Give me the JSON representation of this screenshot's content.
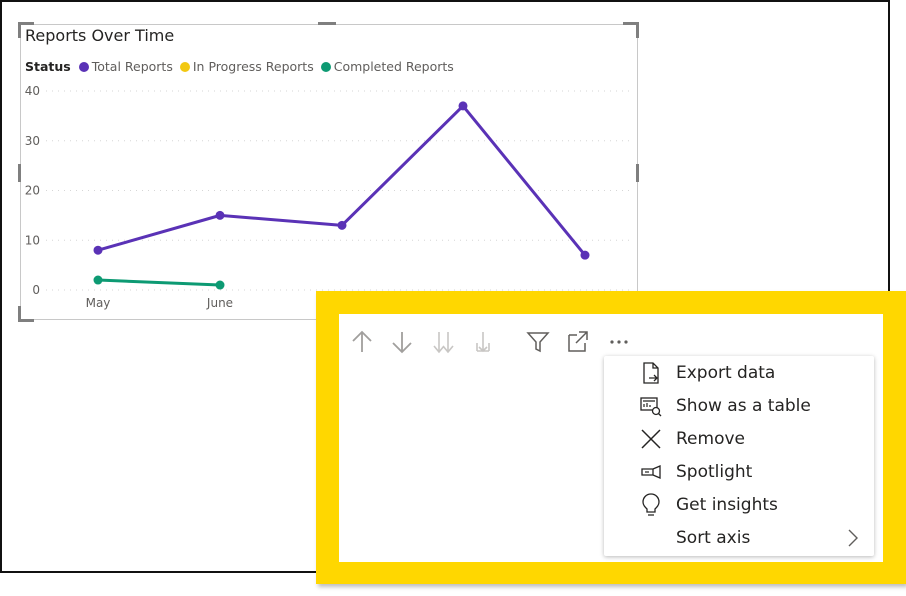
{
  "visual": {
    "title": "Reports Over Time",
    "legend": {
      "title": "Status",
      "items": [
        {
          "label": "Total Reports",
          "color": "#5a32b6"
        },
        {
          "label": "In Progress Reports",
          "color": "#f2c811"
        },
        {
          "label": "Completed Reports",
          "color": "#0d9a73"
        }
      ]
    }
  },
  "chart_data": {
    "type": "line",
    "title": "Reports Over Time",
    "xlabel": "",
    "ylabel": "",
    "ylim": [
      0,
      40
    ],
    "yticks": [
      "0",
      "10",
      "20",
      "30",
      "40"
    ],
    "categories": [
      "May",
      "June",
      "",
      "",
      ""
    ],
    "grid": true,
    "legend_position": "top-left",
    "series": [
      {
        "name": "Total Reports",
        "color": "#5a32b6",
        "values": [
          8,
          15,
          13,
          37,
          7
        ]
      },
      {
        "name": "In Progress Reports",
        "color": "#f2c811",
        "values": [
          null,
          null,
          null,
          null,
          null
        ]
      },
      {
        "name": "Completed Reports",
        "color": "#0d9a73",
        "values": [
          2,
          1,
          null,
          null,
          null
        ]
      }
    ]
  },
  "toolbar": {
    "buttons": [
      {
        "name": "sort-up-icon"
      },
      {
        "name": "sort-down-icon"
      },
      {
        "name": "expand-all-down-icon"
      },
      {
        "name": "expand-hierarchy-icon"
      },
      {
        "name": "filter-icon"
      },
      {
        "name": "focus-mode-icon"
      },
      {
        "name": "more-options-icon"
      }
    ]
  },
  "context_menu": {
    "items": [
      {
        "label": "Export data",
        "icon": "export-data-icon"
      },
      {
        "label": "Show as a table",
        "icon": "show-as-table-icon"
      },
      {
        "label": "Remove",
        "icon": "remove-icon"
      },
      {
        "label": "Spotlight",
        "icon": "spotlight-icon"
      },
      {
        "label": "Get insights",
        "icon": "lightbulb-icon"
      },
      {
        "label": "Sort axis",
        "icon": "chevron-right-icon"
      }
    ]
  },
  "highlight_color": "#ffd700"
}
